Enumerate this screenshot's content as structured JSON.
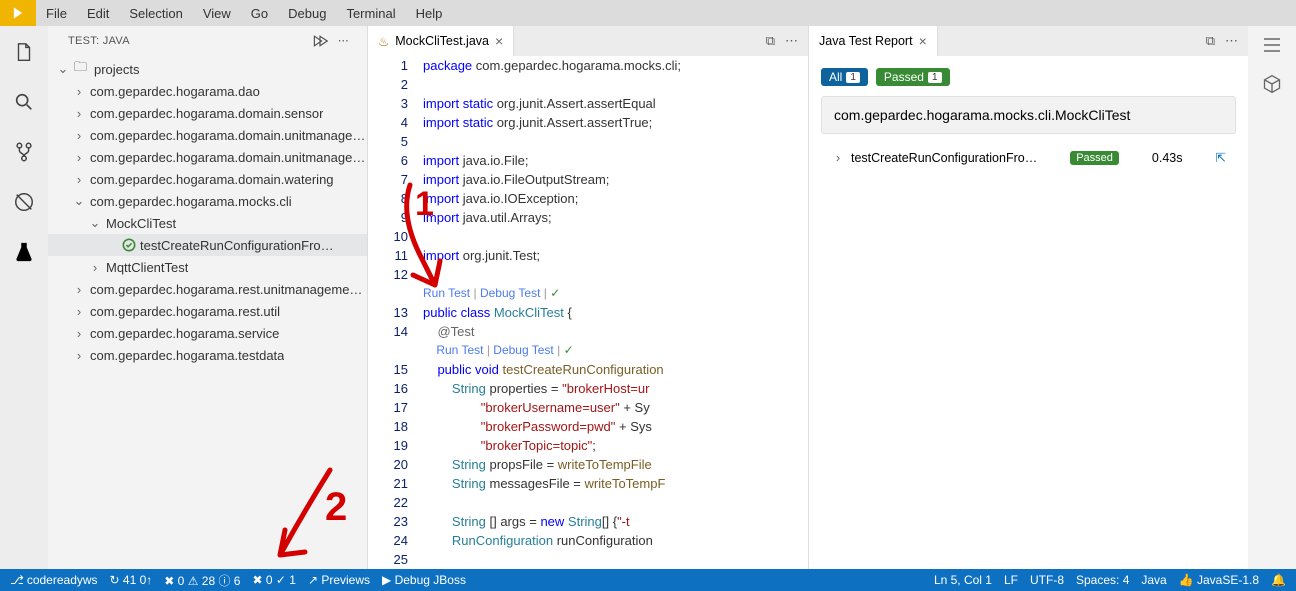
{
  "menu": {
    "items": [
      "File",
      "Edit",
      "Selection",
      "View",
      "Go",
      "Debug",
      "Terminal",
      "Help"
    ]
  },
  "sidebar": {
    "title": "TEST: JAVA",
    "tree": {
      "root": "projects",
      "pkgs": [
        "com.gepardec.hogarama.dao",
        "com.gepardec.hogarama.domain.sensor",
        "com.gepardec.hogarama.domain.unitmanage…",
        "com.gepardec.hogarama.domain.unitmanage…",
        "com.gepardec.hogarama.domain.watering",
        "com.gepardec.hogarama.mocks.cli",
        "com.gepardec.hogarama.rest.unitmanageme…",
        "com.gepardec.hogarama.rest.util",
        "com.gepardec.hogarama.service",
        "com.gepardec.hogarama.testdata"
      ],
      "cliTests": [
        "MockCliTest",
        "MqttClientTest"
      ],
      "selectedMethod": "testCreateRunConfigurationFro…"
    }
  },
  "tabs": {
    "left": "MockCliTest.java",
    "right": "Java Test Report"
  },
  "code": {
    "lines": [
      {
        "n": 1,
        "kind": "pkg",
        "frag": [
          [
            "package ",
            "kw"
          ],
          [
            "com.gepardec.hogarama.mocks.cli;",
            "pkg"
          ]
        ]
      },
      {
        "n": 2,
        "kind": "blank"
      },
      {
        "n": 3,
        "frag": [
          [
            "import ",
            "kw"
          ],
          [
            "static ",
            "kw"
          ],
          [
            "org.junit.Assert.assertEqual",
            "pkg"
          ]
        ]
      },
      {
        "n": 4,
        "frag": [
          [
            "import ",
            "kw"
          ],
          [
            "static ",
            "kw"
          ],
          [
            "org.junit.Assert.assertTrue;",
            "pkg"
          ]
        ]
      },
      {
        "n": 5,
        "kind": "blank"
      },
      {
        "n": 6,
        "frag": [
          [
            "import ",
            "kw"
          ],
          [
            "java.io.File;",
            "pkg"
          ]
        ]
      },
      {
        "n": 7,
        "frag": [
          [
            "import ",
            "kw"
          ],
          [
            "java.io.FileOutputStream;",
            "pkg"
          ]
        ]
      },
      {
        "n": 8,
        "frag": [
          [
            "import ",
            "kw"
          ],
          [
            "java.io.IOException;",
            "pkg"
          ]
        ]
      },
      {
        "n": 9,
        "frag": [
          [
            "import ",
            "kw"
          ],
          [
            "java.util.Arrays;",
            "pkg"
          ]
        ]
      },
      {
        "n": 10,
        "kind": "blank"
      },
      {
        "n": 11,
        "frag": [
          [
            "import ",
            "kw"
          ],
          [
            "org.junit.Test;",
            "pkg"
          ]
        ]
      },
      {
        "n": 12,
        "kind": "blank"
      },
      {
        "n": "",
        "kind": "codelens",
        "text": "Run Test | Debug Test | ✓"
      },
      {
        "n": 13,
        "frag": [
          [
            "public ",
            "kw"
          ],
          [
            "class ",
            "kw"
          ],
          [
            "MockCliTest ",
            "typ"
          ],
          [
            "{",
            ""
          ]
        ]
      },
      {
        "n": 14,
        "indent": 2,
        "frag": [
          [
            "@Test",
            "ann"
          ]
        ]
      },
      {
        "n": "",
        "kind": "codelens",
        "indent": 2,
        "text": "Run Test | Debug Test | ✓"
      },
      {
        "n": 15,
        "indent": 2,
        "frag": [
          [
            "public ",
            "kw"
          ],
          [
            "void ",
            "kw"
          ],
          [
            "testCreateRunConfiguration",
            "mth"
          ]
        ]
      },
      {
        "n": 16,
        "indent": 4,
        "frag": [
          [
            "String ",
            "typ"
          ],
          [
            "properties = ",
            ""
          ],
          [
            "\"brokerHost=ur",
            "str"
          ]
        ]
      },
      {
        "n": 17,
        "indent": 8,
        "frag": [
          [
            "\"brokerUsername=user\"",
            "str"
          ],
          [
            " + Sy",
            ""
          ]
        ]
      },
      {
        "n": 18,
        "indent": 8,
        "frag": [
          [
            "\"brokerPassword=pwd\"",
            "str"
          ],
          [
            " + Sys",
            ""
          ]
        ]
      },
      {
        "n": 19,
        "indent": 8,
        "frag": [
          [
            "\"brokerTopic=topic\"",
            "str"
          ],
          [
            ";",
            ""
          ]
        ]
      },
      {
        "n": 20,
        "indent": 4,
        "frag": [
          [
            "String ",
            "typ"
          ],
          [
            "propsFile = ",
            ""
          ],
          [
            "writeToTempFile",
            "mth"
          ]
        ]
      },
      {
        "n": 21,
        "indent": 4,
        "frag": [
          [
            "String ",
            "typ"
          ],
          [
            "messagesFile = ",
            ""
          ],
          [
            "writeToTempF",
            "mth"
          ]
        ]
      },
      {
        "n": 22,
        "kind": "blank"
      },
      {
        "n": 23,
        "indent": 4,
        "frag": [
          [
            "String ",
            "typ"
          ],
          [
            "[] args = ",
            ""
          ],
          [
            "new ",
            "kw"
          ],
          [
            "String",
            "typ"
          ],
          [
            "[] {",
            ""
          ],
          [
            "\"-t",
            "str"
          ]
        ]
      },
      {
        "n": 24,
        "indent": 4,
        "frag": [
          [
            "RunConfiguration ",
            "typ"
          ],
          [
            "runConfiguration",
            ""
          ]
        ]
      },
      {
        "n": 25,
        "kind": "blank"
      }
    ],
    "codelens_run": "Run Test",
    "codelens_debug": "Debug Test"
  },
  "report": {
    "all": "All",
    "allCount": "1",
    "passed": "Passed",
    "passedCount": "1",
    "classTitle": "com.gepardec.hogarama.mocks.cli.MockCliTest",
    "item": {
      "name": "testCreateRunConfigurationFro…",
      "status": "Passed",
      "time": "0.43s"
    }
  },
  "status": {
    "left": {
      "ws": "codereadyws",
      "sync": "↻ 41 0↑",
      "diag1": "✖ 0 ⚠ 28 ⓘ 6",
      "diag2": "✖ 0 ✓ 1",
      "previews": "↗ Previews",
      "debug": "▶ Debug JBoss"
    },
    "right": {
      "pos": "Ln 5, Col 1",
      "eol": "LF",
      "enc": "UTF-8",
      "spaces": "Spaces: 4",
      "lang": "Java",
      "jdk": "👍  JavaSE-1.8",
      "bell": "🔔"
    }
  },
  "annotations": {
    "one": "1",
    "two": "2"
  }
}
